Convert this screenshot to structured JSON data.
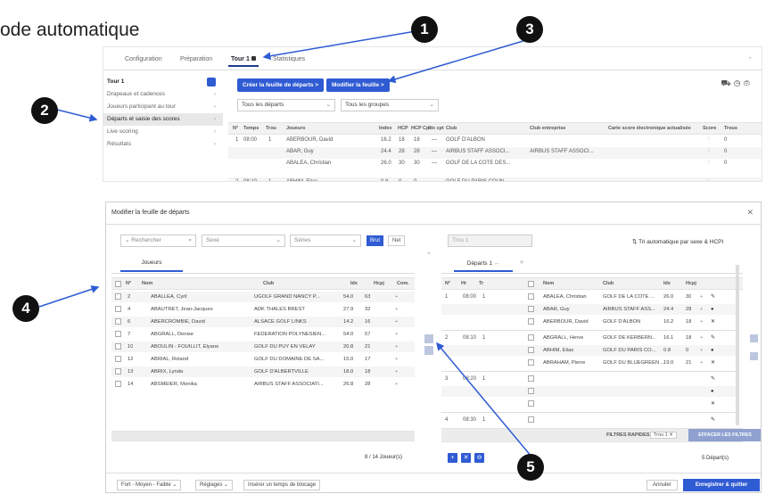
{
  "heading": "ode automatique",
  "markers": [
    "1",
    "2",
    "3",
    "4",
    "5"
  ],
  "top": {
    "tabs": [
      "Configuration",
      "Préparation",
      "Tour 1",
      "Statistiques"
    ],
    "sidebar": [
      {
        "label": "Tour 1",
        "kind": "head"
      },
      {
        "label": "Drapeaux et cadences",
        "kind": "item"
      },
      {
        "label": "Joueurs participant au tour",
        "kind": "item"
      },
      {
        "label": "Départs et saisie des scores",
        "kind": "sel"
      },
      {
        "label": "Live scoring",
        "kind": "item"
      },
      {
        "label": "Résultats",
        "kind": "item"
      }
    ],
    "create_label": "Créer la feuille de départs  >",
    "modify_label": "Modifier la feuille  >",
    "filter1": "Tous les départs",
    "filter2": "Tous les groupes",
    "columns": [
      "N°",
      "Temps",
      "Trou",
      "Joueurs",
      "Index",
      "HCP",
      "HCP Cpt",
      "Idx cpt",
      "Club",
      "Club entreprise",
      "Carte score électronique actualisée",
      "Score",
      "Trous"
    ],
    "rows": [
      {
        "n": "1",
        "temps": "08:00",
        "trou": "1",
        "joueur": "ABERBOUR, David",
        "index": "16.2",
        "hcp": "18",
        "hcpcpt": "18",
        "idxcpt": "—",
        "club": "GOLF D'ALBON",
        "entreprise": "",
        "score": "0"
      },
      {
        "n": "",
        "temps": "",
        "trou": "",
        "joueur": "ABAR, Guy",
        "index": "24.4",
        "hcp": "28",
        "hcpcpt": "28",
        "idxcpt": "—",
        "club": "AIRBUS STAFF ASSOCI...",
        "entreprise": "AIRBUS STAFF ASSOCI...",
        "score": "0"
      },
      {
        "n": "",
        "temps": "",
        "trou": "",
        "joueur": "ABALEA, Christian",
        "index": "26.0",
        "hcp": "30",
        "hcpcpt": "30",
        "idxcpt": "—",
        "club": "GOLF DE LA COTE DES...",
        "entreprise": "",
        "score": "0"
      },
      {
        "n": "2",
        "temps": "08:10",
        "trou": "1",
        "joueur": "ABHIM, Elias",
        "index": "0.8",
        "hcp": "0",
        "hcpcpt": "0",
        "idxcpt": "—",
        "club": "GOLF DU PARIS COUN...",
        "entreprise": "",
        "score": ""
      }
    ]
  },
  "modal": {
    "title": "Modifier la feuille de départs",
    "search_placeholder": "Rechercher",
    "sexe": "Sexe",
    "series": "Séries",
    "brut": "Brut",
    "net": "Net",
    "tab_players": "Joueurs",
    "left_columns": [
      "N°",
      "Nom",
      "Club",
      "Idx",
      "Hcpj",
      "Com."
    ],
    "players": [
      {
        "n": "2",
        "nom": "ABALLEA, Cyril",
        "club": "UGOLF GRAND NANCY P...",
        "idx": "54.0",
        "hcp": "63"
      },
      {
        "n": "4",
        "nom": "ABAUTRET, Jean-Jacques",
        "club": "ADK THALES BREST",
        "idx": "27.9",
        "hcp": "32"
      },
      {
        "n": "6",
        "nom": "ABERCROMBIE, David",
        "club": "ALSACE GOLF LINKS",
        "idx": "14.2",
        "hcp": "16"
      },
      {
        "n": "7",
        "nom": "ABGRALL, Denise",
        "club": "FEDERATION POLYNESIEN...",
        "idx": "54.0",
        "hcp": "57"
      },
      {
        "n": "10",
        "nom": "ABOULIN - FOUILLIT, Elyane",
        "club": "GOLF DU PUY EN VELAY",
        "idx": "20.8",
        "hcp": "21"
      },
      {
        "n": "12",
        "nom": "ABRIAL, Roland",
        "club": "GOLF DU DOMAINE DE SA...",
        "idx": "15.0",
        "hcp": "17"
      },
      {
        "n": "13",
        "nom": "ABRIX, Lynda",
        "club": "GOLF D'ALBERTVILLE",
        "idx": "18.0",
        "hcp": "18"
      },
      {
        "n": "14",
        "nom": "ABSMEIER, Monika",
        "club": "AIRBUS STAFF ASSOCIATI...",
        "idx": "26.8",
        "hcp": "28"
      }
    ],
    "player_count": "8 / 14 Joueur(s)",
    "trou_placeholder": "Trou 1",
    "tri_label": "Tri automatique par sexe & HCPI",
    "departs_tab": "Départs 1",
    "right_columns": [
      "N°",
      "Hr",
      "Tr",
      "Nom",
      "Club",
      "Idx",
      "Hcpj"
    ],
    "groups": [
      {
        "n": "1",
        "hr": "08:00",
        "tr": "1",
        "players": [
          {
            "nom": "ABALEA, Christian",
            "club": "GOLF DE LA COTE ...",
            "idx": "26.0",
            "hcp": "30"
          },
          {
            "nom": "ABAR, Guy",
            "club": "AIRBUS STAFF ASS...",
            "idx": "24.4",
            "hcp": "28"
          },
          {
            "nom": "ABERBOUR, David",
            "club": "GOLF D'ALBON",
            "idx": "16.2",
            "hcp": "18"
          }
        ]
      },
      {
        "n": "2",
        "hr": "08:10",
        "tr": "1",
        "players": [
          {
            "nom": "ABGRALL, Herve",
            "club": "GOLF DE KERBERN...",
            "idx": "16.1",
            "hcp": "18"
          },
          {
            "nom": "ABHIM, Elias",
            "club": "GOLF DU PARIS CO...",
            "idx": "0.8",
            "hcp": "0"
          },
          {
            "nom": "ABRAHAM, Pierre",
            "club": "GOLF DU BLUEGREEN ...",
            "idx": "19.0",
            "hcp": "21"
          }
        ]
      },
      {
        "n": "3",
        "hr": "08:20",
        "tr": "1",
        "players": [
          {
            "nom": "",
            "club": "",
            "idx": "",
            "hcp": ""
          },
          {
            "nom": "",
            "club": "",
            "idx": "",
            "hcp": ""
          },
          {
            "nom": "",
            "club": "",
            "idx": "",
            "hcp": ""
          }
        ]
      },
      {
        "n": "4",
        "hr": "08:30",
        "tr": "1",
        "players": [
          {
            "nom": "",
            "club": "",
            "idx": "",
            "hcp": ""
          }
        ]
      }
    ],
    "filtres_rapides": "FILTRES RAPIDES",
    "filter_chip": "Trou 1",
    "clear_filters": "EFFACER LES FILTRES",
    "departs_count": "5 Départ(s)",
    "foot_level": "Fort - Moyen - Faible",
    "foot_reglages": "Réglages",
    "foot_insert": "Insérer un temps de blocage",
    "cancel": "Annuler",
    "save": "Enregistrer & quitter"
  }
}
